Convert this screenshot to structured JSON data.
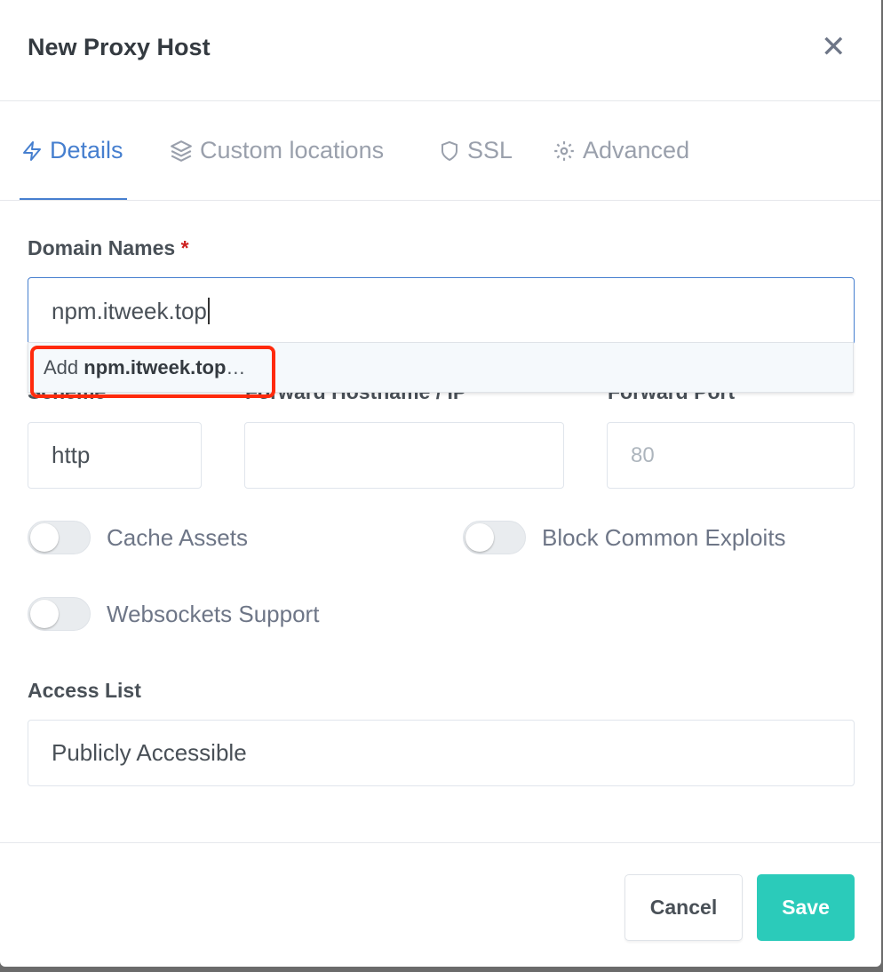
{
  "modal": {
    "title": "New Proxy Host",
    "close_icon": "close-icon"
  },
  "tabs": [
    {
      "label": "Details",
      "icon": "lightning-icon",
      "active": true
    },
    {
      "label": "Custom locations",
      "icon": "layers-icon"
    },
    {
      "label": "SSL",
      "icon": "shield-icon"
    },
    {
      "label": "Advanced",
      "icon": "gear-icon"
    }
  ],
  "form": {
    "domain_label": "Domain Names",
    "required_mark": "*",
    "domain_value": "npm.itweek.top",
    "suggestion_prefix": "Add",
    "suggestion_value": "npm.itweek.top",
    "suggestion_suffix": "…",
    "scheme_label": "Scheme",
    "scheme_value": "http",
    "hostname_label": "Forward Hostname / IP",
    "hostname_value": "",
    "port_label": "Forward Port",
    "port_placeholder": "80",
    "toggles": [
      {
        "label": "Cache Assets",
        "on": false
      },
      {
        "label": "Block Common Exploits",
        "on": false
      },
      {
        "label": "Websockets Support",
        "on": false
      }
    ],
    "access_label": "Access List",
    "access_value": "Publicly Accessible"
  },
  "footer": {
    "cancel": "Cancel",
    "save": "Save"
  },
  "colors": {
    "accent": "#467fcf",
    "save": "#2bcbba",
    "highlight": "#ff2a0c"
  }
}
